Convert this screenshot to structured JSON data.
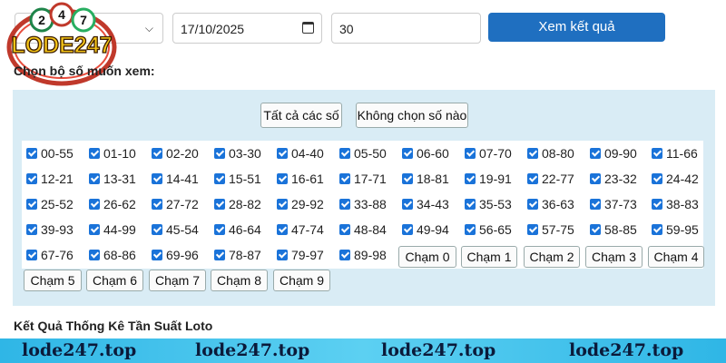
{
  "form": {
    "date_value": "17/10/2025",
    "count_value": "30",
    "submit_label": "Xem kết quả"
  },
  "logo": {
    "text": "LODE247",
    "ball_digits": [
      "2",
      "4",
      "7"
    ]
  },
  "select_section": {
    "title": "Chọn bộ số muốn xem:",
    "select_all_label": "Tất cả các số",
    "select_none_label": "Không chọn số nào"
  },
  "pairs": [
    [
      "00-55",
      "01-10",
      "02-20",
      "03-30",
      "04-40",
      "05-50",
      "06-60",
      "07-70",
      "08-80",
      "09-90",
      "11-66"
    ],
    [
      "12-21",
      "13-31",
      "14-41",
      "15-51",
      "16-61",
      "17-71",
      "18-81",
      "19-91",
      "22-77",
      "23-32",
      "24-42"
    ],
    [
      "25-52",
      "26-62",
      "27-72",
      "28-82",
      "29-92",
      "33-88",
      "34-43",
      "35-53",
      "36-63",
      "37-73",
      "38-83"
    ],
    [
      "39-93",
      "44-99",
      "45-54",
      "46-64",
      "47-74",
      "48-84",
      "49-94",
      "56-65",
      "57-75",
      "58-85",
      "59-95"
    ],
    [
      "67-76",
      "68-86",
      "69-96",
      "78-87",
      "79-97",
      "89-98"
    ]
  ],
  "cham_buttons": [
    "Chạm 0",
    "Chạm 1",
    "Chạm 2",
    "Chạm 3",
    "Chạm 4",
    "Chạm 5",
    "Chạm 6",
    "Chạm 7",
    "Chạm 8",
    "Chạm 9"
  ],
  "result_title": "Kết Quả Thống Kê Tần Suất Loto",
  "footer": {
    "items": [
      "lode247.top",
      "lode247.top",
      "lode247.top",
      "lode247.top"
    ]
  },
  "colors": {
    "accent": "#1f6fc0",
    "panel_bg": "#d9ecf5",
    "checkbox": "#1a73d9",
    "footer_bar": "#2fb6e6",
    "logo_text": "#f5c518"
  }
}
